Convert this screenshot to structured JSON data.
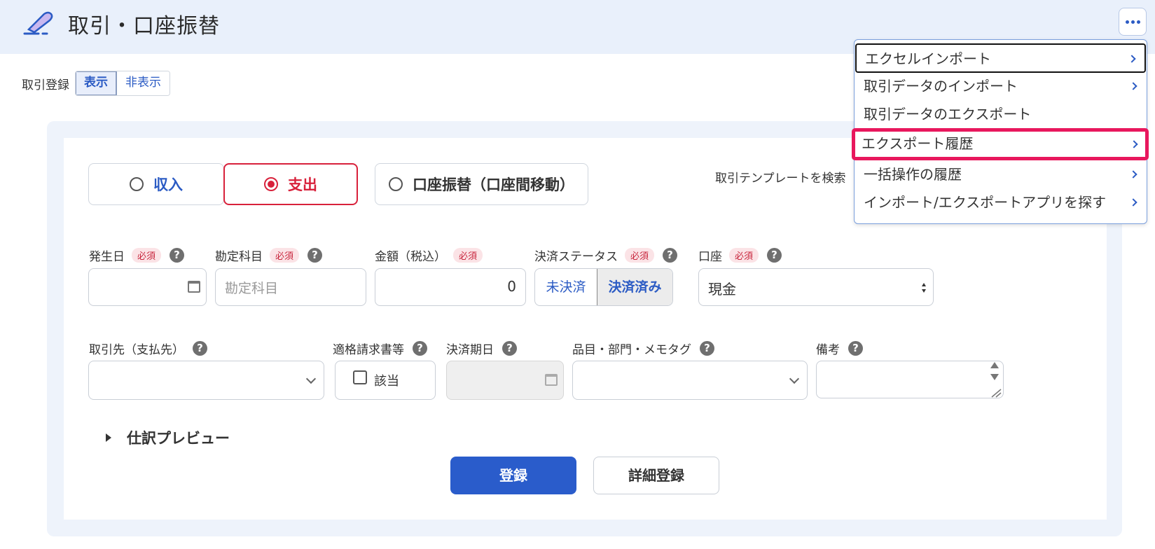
{
  "header": {
    "title": "取引・口座振替",
    "logo_icon": "pen-icon",
    "more_icon": "ellipsis-icon"
  },
  "registration": {
    "label": "取引登録",
    "show": "表示",
    "hide": "非表示",
    "selected": "表示"
  },
  "type_tabs": [
    {
      "label": "収入",
      "color": "#2b5bc4",
      "selected": false
    },
    {
      "label": "支出",
      "color": "#d8213b",
      "selected": true
    },
    {
      "label": "口座振替（口座間移動）",
      "color": "#333333",
      "selected": false
    }
  ],
  "template_search": {
    "label": "取引テンプレートを検索"
  },
  "required_badge": "必須",
  "help_glyph": "?",
  "fields": {
    "date": {
      "label": "発生日",
      "value": ""
    },
    "account_item": {
      "label": "勘定科目",
      "placeholder": "勘定科目"
    },
    "amount": {
      "label": "金額（税込）",
      "value": "0"
    },
    "settlement_status": {
      "label": "決済ステータス",
      "options": [
        "未決済",
        "決済済み"
      ],
      "selected": "決済済み"
    },
    "wallet": {
      "label": "口座",
      "value": "現金"
    },
    "partner": {
      "label": "取引先（支払先）",
      "value": ""
    },
    "qualified_invoice": {
      "label": "適格請求書等",
      "checkbox_label": "該当",
      "checked": false
    },
    "due_date": {
      "label": "決済期日",
      "value": ""
    },
    "tags": {
      "label": "品目・部門・メモタグ",
      "value": ""
    },
    "memo": {
      "label": "備考",
      "value": ""
    }
  },
  "preview": {
    "label": "仕訳プレビュー"
  },
  "buttons": {
    "register": "登録",
    "detail_register": "詳細登録"
  },
  "dropdown_menu": {
    "items": [
      {
        "label": "エクセルインポート",
        "has_submenu": true,
        "focused": true
      },
      {
        "label": "取引データのインポート",
        "has_submenu": true
      },
      {
        "label": "取引データのエクスポート",
        "has_submenu": false
      },
      {
        "label": "エクスポート履歴",
        "has_submenu": true,
        "highlighted": true
      },
      {
        "label": "一括操作の履歴",
        "has_submenu": true
      },
      {
        "label": "インポート/エクスポートアプリを探す",
        "has_submenu": true
      }
    ]
  },
  "colors": {
    "accent": "#2b5bc4",
    "expense": "#d8213b",
    "primary_button": "#2a5ccb",
    "highlight_border": "#e8175d",
    "header_bg": "#e9f0fb"
  }
}
